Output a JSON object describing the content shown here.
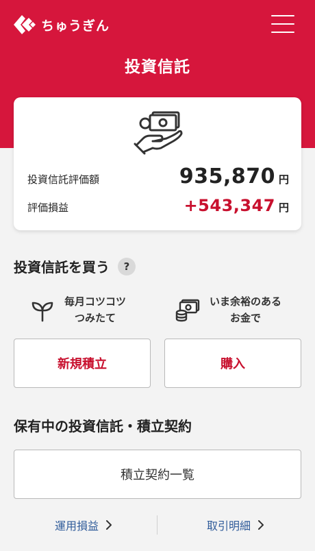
{
  "header": {
    "brand": "ちゅうぎん",
    "title": "投資信託",
    "menu_icon": "hamburger-menu-icon",
    "brand_color": "#d6163c"
  },
  "summary": {
    "icon": "money-in-hand-icon",
    "valuation_label": "投資信託評価額",
    "valuation_value": "935,870",
    "valuation_unit": "円",
    "gain_label": "評価損益",
    "gain_value": "+543,347",
    "gain_unit": "円",
    "gain_color": "#c8102e"
  },
  "buy": {
    "title": "投資信託を買う",
    "help": "?",
    "feature_left": {
      "icon": "sprout-icon",
      "line1": "毎月コツコツ",
      "line2": "つみたて"
    },
    "feature_right": {
      "icon": "cash-coins-icon",
      "line1": "いま余裕のある",
      "line2": "お金で"
    },
    "btn_new": "新規積立",
    "btn_buy": "購入"
  },
  "holdings": {
    "title": "保有中の投資信託・積立契約",
    "btn_contracts": "積立契約一覧"
  },
  "links": {
    "left": "運用損益",
    "right": "取引明細",
    "chevron": "›"
  }
}
